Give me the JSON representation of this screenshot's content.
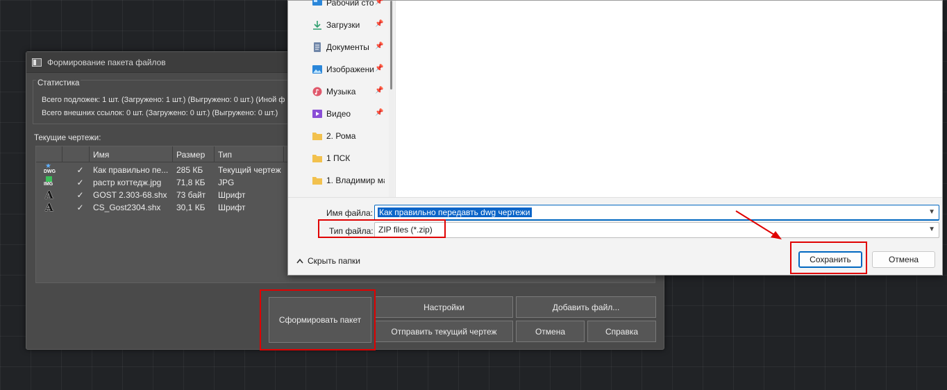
{
  "pack_dialog": {
    "title": "Формирование пакета файлов",
    "stats_label": "Статистика",
    "stats_lines": [
      "Всего подложек: 1 шт. (Загружено: 1 шт.) (Выгружено: 0 шт.) (Иной ф",
      "Всего внешних ссылок: 0 шт. (Загружено: 0 шт.) (Выгружено: 0 шт.)"
    ],
    "drawings_label": "Текущие чертежи:",
    "columns": {
      "name": "Имя",
      "size": "Размер",
      "type": "Тип"
    },
    "rows": [
      {
        "icon": "dwg-file-icon",
        "icon_text": "DWG",
        "check": "✓",
        "name": "Как правильно пе...",
        "size": "285 КБ",
        "type": "Текущий чертеж"
      },
      {
        "icon": "image-file-icon",
        "icon_text": "IMG",
        "check": "✓",
        "name": "растр коттедж.jpg",
        "size": "71,8 КБ",
        "type": "JPG"
      },
      {
        "icon": "font-file-icon",
        "icon_text": "A",
        "check": "✓",
        "name": "GOST 2.303-68.shx",
        "size": "73 байт",
        "type": "Шрифт"
      },
      {
        "icon": "font-file-icon",
        "icon_text": "A",
        "check": "✓",
        "name": "CS_Gost2304.shx",
        "size": "30,1 КБ",
        "type": "Шрифт"
      }
    ],
    "buttons": {
      "create_package": "Сформировать пакет",
      "settings": "Настройки",
      "add_file": "Добавить файл...",
      "send_current": "Отправить текущий чертеж",
      "cancel": "Отмена",
      "help": "Справка"
    }
  },
  "save_dialog": {
    "nav_items": [
      {
        "label": "Рабочий сто",
        "icon": "desktop-icon",
        "pinned": true
      },
      {
        "label": "Загрузки",
        "icon": "download-icon",
        "pinned": true
      },
      {
        "label": "Документы",
        "icon": "documents-icon",
        "pinned": true
      },
      {
        "label": "Изображени",
        "icon": "pictures-icon",
        "pinned": true
      },
      {
        "label": "Музыка",
        "icon": "music-icon",
        "pinned": true
      },
      {
        "label": "Видео",
        "icon": "video-icon",
        "pinned": true
      },
      {
        "label": "2. Рома",
        "icon": "folder-icon",
        "pinned": false
      },
      {
        "label": "1 ПСК",
        "icon": "folder-icon",
        "pinned": false
      },
      {
        "label": "1. Владимир ма",
        "icon": "folder-icon",
        "pinned": false
      }
    ],
    "pin_glyph": "📌",
    "filename_label": "Имя файла:",
    "filename_value": "Как правильно передавть dwg чертежи",
    "filetype_label": "Тип файла:",
    "filetype_value": "ZIP files (*.zip)",
    "hide_folders": "Скрыть папки",
    "save_button": "Сохранить",
    "cancel_button": "Отмена"
  },
  "colors": {
    "highlight": "#e00000",
    "accent": "#0067c0"
  }
}
